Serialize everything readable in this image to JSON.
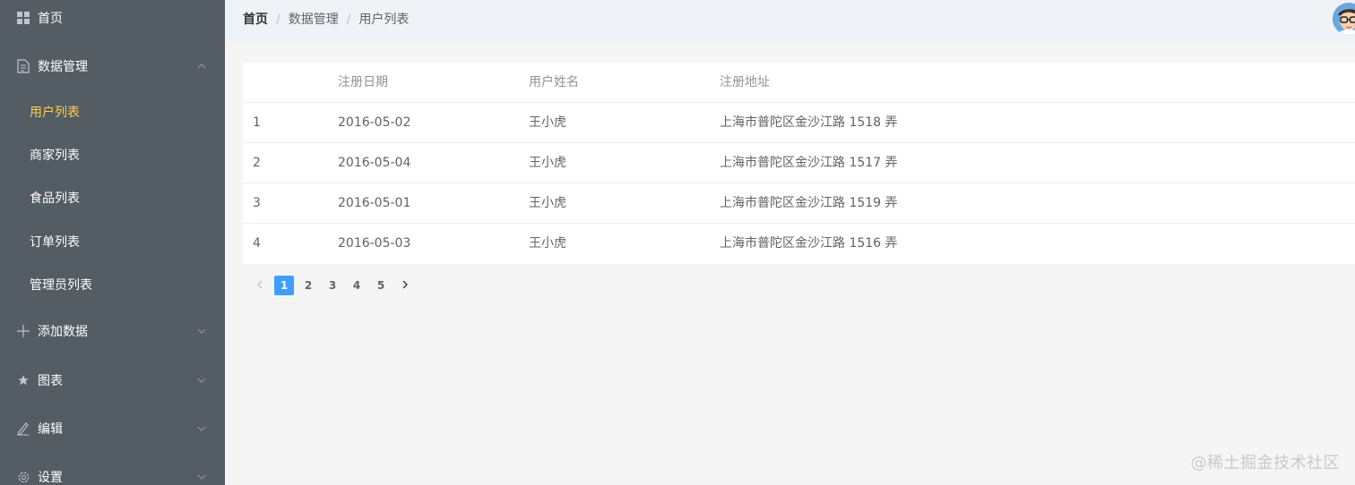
{
  "sidebar": {
    "home": "首页",
    "data_mgmt": "数据管理",
    "sub_items": [
      "用户列表",
      "商家列表",
      "食品列表",
      "订单列表",
      "管理员列表"
    ],
    "add_data": "添加数据",
    "charts": "图表",
    "edit": "编辑",
    "settings": "设置",
    "active_color": "#ffd04b",
    "bg_color": "#545c64"
  },
  "header": {
    "breadcrumb": [
      "首页",
      "数据管理",
      "用户列表"
    ],
    "separator": "/"
  },
  "table": {
    "columns": [
      "",
      "注册日期",
      "用户姓名",
      "注册地址"
    ],
    "rows": [
      [
        "1",
        "2016-05-02",
        "王小虎",
        "上海市普陀区金沙江路 1518 弄"
      ],
      [
        "2",
        "2016-05-04",
        "王小虎",
        "上海市普陀区金沙江路 1517 弄"
      ],
      [
        "3",
        "2016-05-01",
        "王小虎",
        "上海市普陀区金沙江路 1519 弄"
      ],
      [
        "4",
        "2016-05-03",
        "王小虎",
        "上海市普陀区金沙江路 1516 弄"
      ]
    ]
  },
  "pagination": {
    "pages": [
      "1",
      "2",
      "3",
      "4",
      "5"
    ],
    "current": "1",
    "prev_icon": "chevron-left-icon",
    "next_icon": "chevron-right-icon"
  },
  "watermark": "@稀土掘金技术社区"
}
